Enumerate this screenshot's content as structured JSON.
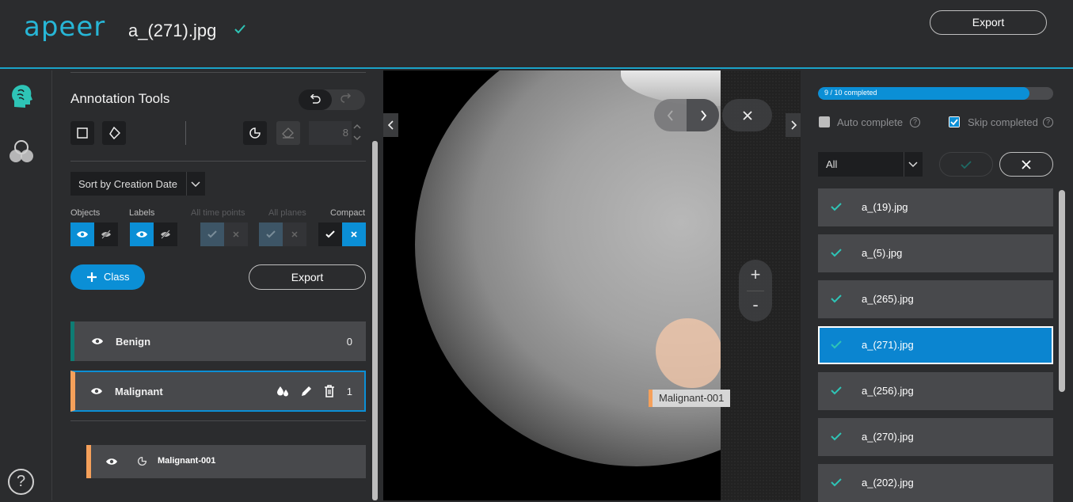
{
  "header": {
    "logo": "apeer",
    "file_title": "a_(271).jpg",
    "export_label": "Export"
  },
  "nav": {
    "items": [
      "brain-icon",
      "color-channels-icon"
    ],
    "help": "?"
  },
  "panel": {
    "title": "Annotation Tools",
    "brush_size": "8",
    "sort_label": "Sort by Creation Date",
    "toggle_labels": {
      "objects": "Objects",
      "labels": "Labels",
      "all_time_points": "All time points",
      "all_planes": "All planes",
      "compact": "Compact"
    },
    "add_class_label": "Class",
    "export_label": "Export",
    "classes": [
      {
        "name": "Benign",
        "count": "0",
        "color": "#0e7c74"
      },
      {
        "name": "Malignant",
        "count": "1",
        "color": "#f5a05a"
      }
    ],
    "objects": [
      {
        "name": "Malignant-001",
        "color": "#f5a05a"
      }
    ]
  },
  "viewer": {
    "annotation_label": "Malignant-001",
    "zoom_in": "+",
    "zoom_out": "-"
  },
  "right": {
    "progress_text": "9 / 10 completed",
    "progress_fraction": 0.9,
    "auto_complete_label": "Auto complete",
    "skip_completed_label": "Skip completed",
    "filter_value": "All",
    "files": [
      {
        "name": "a_(19).jpg",
        "selected": false
      },
      {
        "name": "a_(5).jpg",
        "selected": false
      },
      {
        "name": "a_(265).jpg",
        "selected": false
      },
      {
        "name": "a_(271).jpg",
        "selected": true
      },
      {
        "name": "a_(256).jpg",
        "selected": false
      },
      {
        "name": "a_(270).jpg",
        "selected": false
      },
      {
        "name": "a_(202).jpg",
        "selected": false
      }
    ]
  },
  "colors": {
    "accent": "#0b8fd6",
    "teal": "#27b6d6",
    "check": "#2ec4b6"
  }
}
